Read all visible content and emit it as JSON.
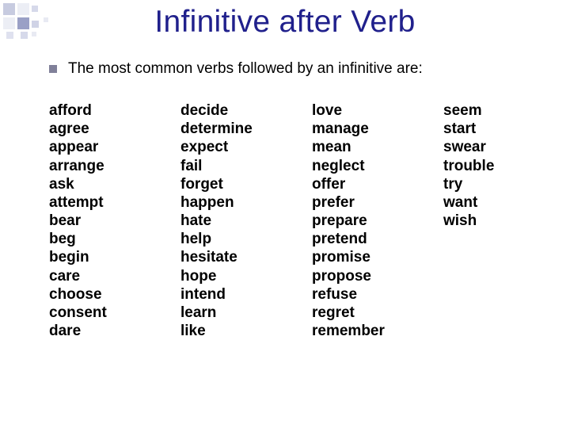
{
  "title": "Infinitive after Verb",
  "subtitle": "The most common verbs followed by an infinitive are:",
  "columns": [
    [
      "afford",
      "agree",
      "appear",
      "arrange",
      "ask",
      "attempt",
      "bear",
      "beg",
      "begin",
      "care",
      "choose",
      "consent",
      "dare"
    ],
    [
      "decide",
      "determine",
      "expect",
      "fail",
      "forget",
      "happen",
      "hate",
      "help",
      "hesitate",
      "hope",
      "intend",
      "learn",
      "like"
    ],
    [
      "love",
      "manage",
      "mean",
      "neglect",
      "offer",
      "prefer",
      "prepare",
      "pretend",
      "promise",
      "propose",
      "refuse",
      "regret",
      "remember"
    ],
    [
      "seem",
      "start",
      "swear",
      "trouble",
      "try",
      "want",
      "wish"
    ]
  ]
}
